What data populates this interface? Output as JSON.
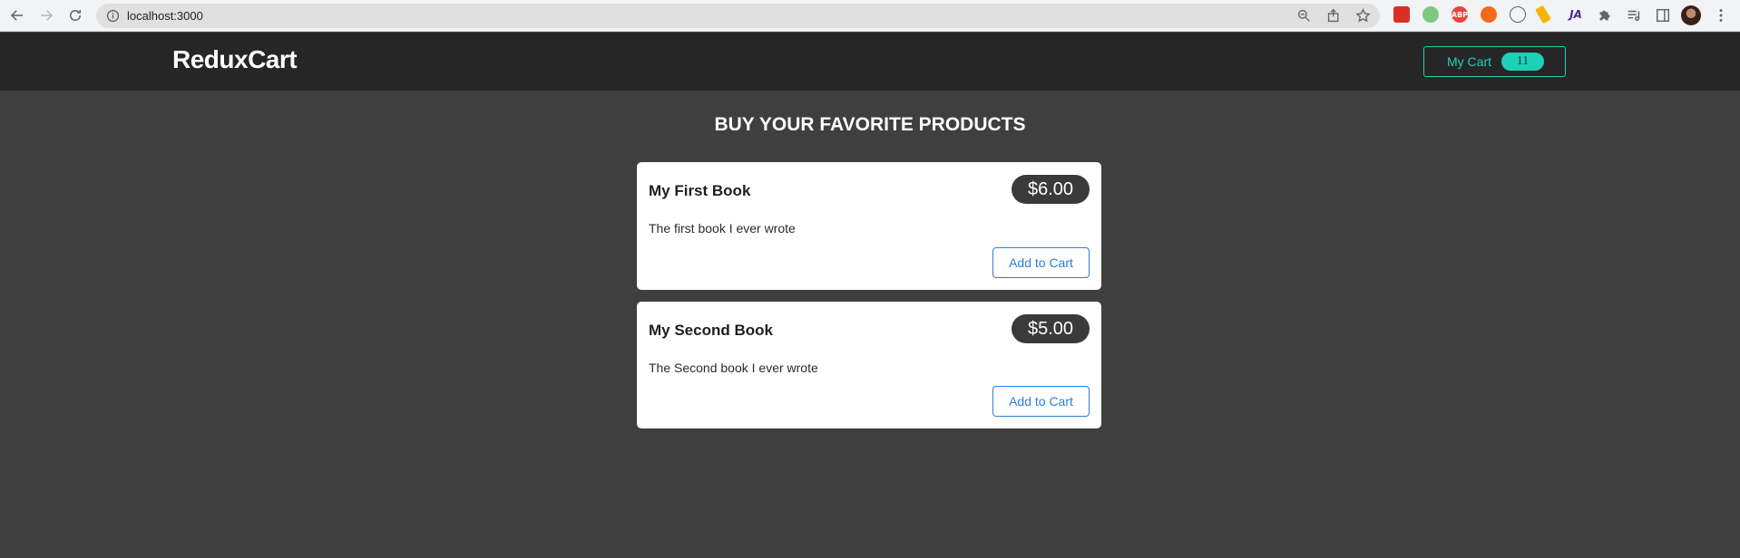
{
  "browser": {
    "url": "localhost:3000",
    "extensions": [
      {
        "name": "ext-red",
        "color": "#d93025",
        "text": ""
      },
      {
        "name": "ext-green",
        "color": "#7fc97f",
        "text": ""
      },
      {
        "name": "adblock",
        "color": "#e8453c",
        "text": "ABP"
      },
      {
        "name": "ext-orange",
        "color": "#f26b1d",
        "text": ""
      },
      {
        "name": "ext-circle",
        "color": "#5f6368",
        "text": ""
      },
      {
        "name": "ext-pencil",
        "color": "#f4b400",
        "text": ""
      },
      {
        "name": "ext-ja",
        "color": "#4b2a8c",
        "text": "JA"
      }
    ]
  },
  "header": {
    "brand": "ReduxCart",
    "cart_label": "My Cart",
    "cart_count": "11"
  },
  "main": {
    "title": "BUY YOUR FAVORITE PRODUCTS",
    "products": [
      {
        "name": "My First Book",
        "price": "$6.00",
        "description": "The first book I ever wrote",
        "button": "Add to Cart"
      },
      {
        "name": "My Second Book",
        "price": "$5.00",
        "description": "The Second book I ever wrote",
        "button": "Add to Cart"
      }
    ]
  },
  "colors": {
    "accent": "#1dd1b8",
    "link": "#2a7fd6",
    "background": "#3f3f3f",
    "header": "#262626"
  }
}
